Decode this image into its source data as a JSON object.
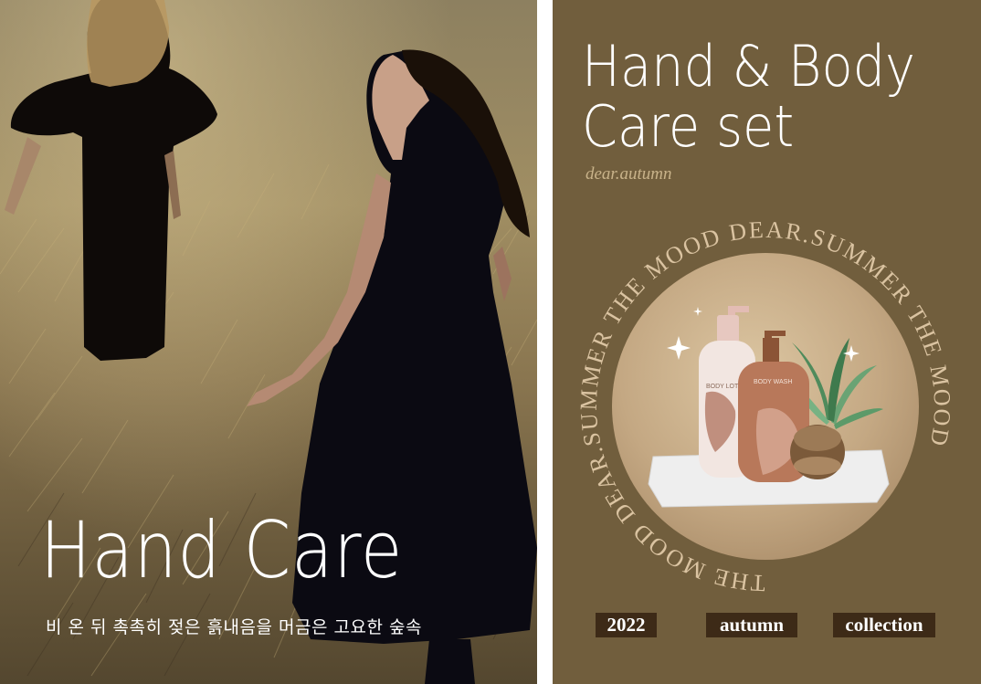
{
  "left_panel": {
    "title": "Hand Care",
    "subtitle": "비 온 뒤 촉촉히 젖은 흙내음을 머금은 고요한 숲속"
  },
  "right_panel": {
    "title_line1": "Hand & Body",
    "title_line2": "Care set",
    "tagline": "dear.autumn",
    "ring_text": "THE MOOD DEAR.SUMMER THE MOOD DEAR.SUMMER THE MOOD",
    "product_labels": {
      "lotion": "BODY LOTION",
      "wash": "BODY WASH"
    },
    "badges": {
      "year": "2022",
      "season": "autumn",
      "collection": "collection"
    }
  },
  "colors": {
    "right_bg": "#715e3d",
    "badge_bg": "#3d2a17",
    "tagline": "#c9b38a",
    "circle": "#c4a883"
  }
}
